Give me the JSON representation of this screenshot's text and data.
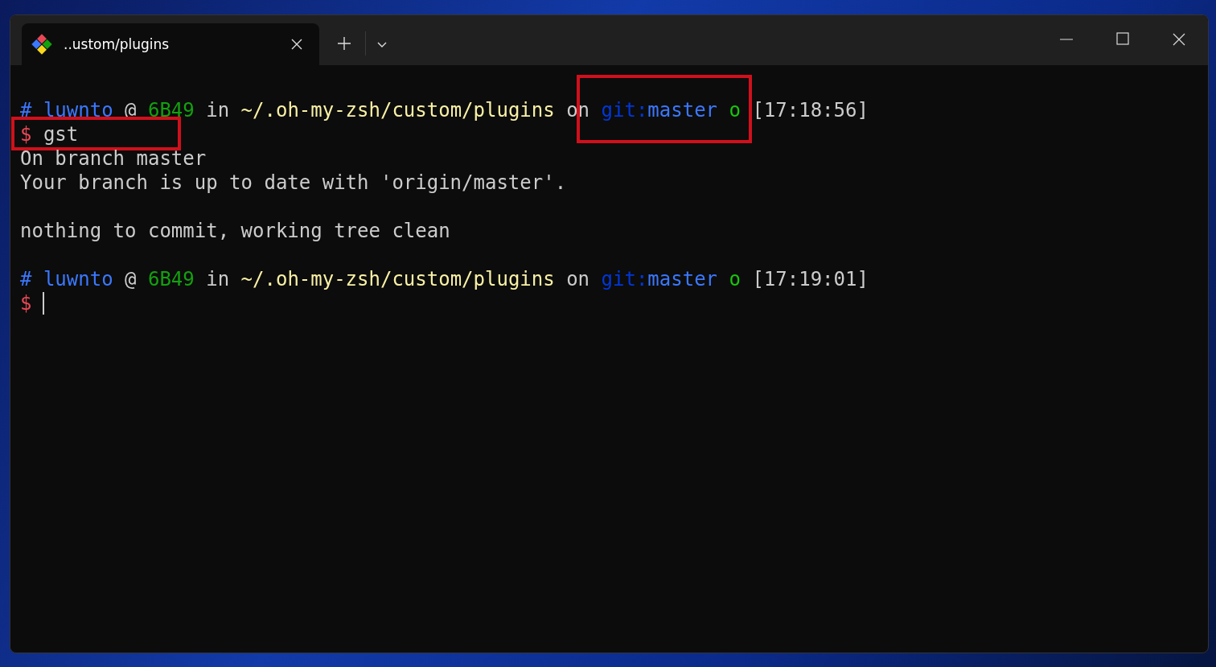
{
  "tabs": [
    {
      "title": "..ustom/plugins",
      "selected": true
    }
  ],
  "terminal": {
    "lines": [
      {
        "kind": "text",
        "highlighted": true,
        "segments": [
          {
            "kind": "prompt-hash",
            "text": "#"
          },
          {
            "kind": "user",
            "text": "luwnto"
          },
          {
            "kind": "plain",
            "text": "@"
          },
          {
            "kind": "host",
            "text": "6B49"
          },
          {
            "kind": "plain",
            "text": "in"
          },
          {
            "kind": "path",
            "text": "~/.oh-my-zsh/custom/plugins"
          },
          {
            "kind": "plain",
            "text": "on"
          },
          {
            "kind": "git-label",
            "text": "git:"
          },
          {
            "kind": "branch",
            "text": "master"
          },
          {
            "kind": "clean-mark",
            "text": "o"
          },
          {
            "kind": "plain",
            "text": "[17:18:56]"
          }
        ]
      },
      {
        "kind": "text",
        "highlighted": true,
        "segments": [
          {
            "kind": "prompt-dollar",
            "text": "$"
          },
          {
            "kind": "plain",
            "text": "gst"
          }
        ]
      },
      {
        "kind": "text",
        "highlighted": false,
        "segments": [
          {
            "kind": "plain",
            "text": "On branch master"
          }
        ]
      },
      {
        "kind": "text",
        "highlighted": false,
        "segments": [
          {
            "kind": "plain",
            "text": "Your branch is up to date with 'origin/master'."
          }
        ]
      },
      {
        "kind": "blank"
      },
      {
        "kind": "text",
        "highlighted": false,
        "segments": [
          {
            "kind": "plain",
            "text": "nothing to commit, working tree clean"
          }
        ]
      },
      {
        "kind": "blank"
      },
      {
        "kind": "text",
        "highlighted": false,
        "segments": [
          {
            "kind": "prompt-hash",
            "text": "#"
          },
          {
            "kind": "user",
            "text": "luwnto"
          },
          {
            "kind": "plain",
            "text": "@"
          },
          {
            "kind": "host",
            "text": "6B49"
          },
          {
            "kind": "plain",
            "text": "in"
          },
          {
            "kind": "path",
            "text": "~/.oh-my-zsh/custom/plugins"
          },
          {
            "kind": "plain",
            "text": "on"
          },
          {
            "kind": "git-label",
            "text": "git:"
          },
          {
            "kind": "branch",
            "text": "master"
          },
          {
            "kind": "clean-mark",
            "text": "o"
          },
          {
            "kind": "plain",
            "text": "[17:19:01]"
          }
        ]
      },
      {
        "kind": "text",
        "highlighted": false,
        "segments": [
          {
            "kind": "prompt-dollar",
            "text": "$"
          },
          {
            "kind": "cursor"
          }
        ]
      }
    ]
  }
}
